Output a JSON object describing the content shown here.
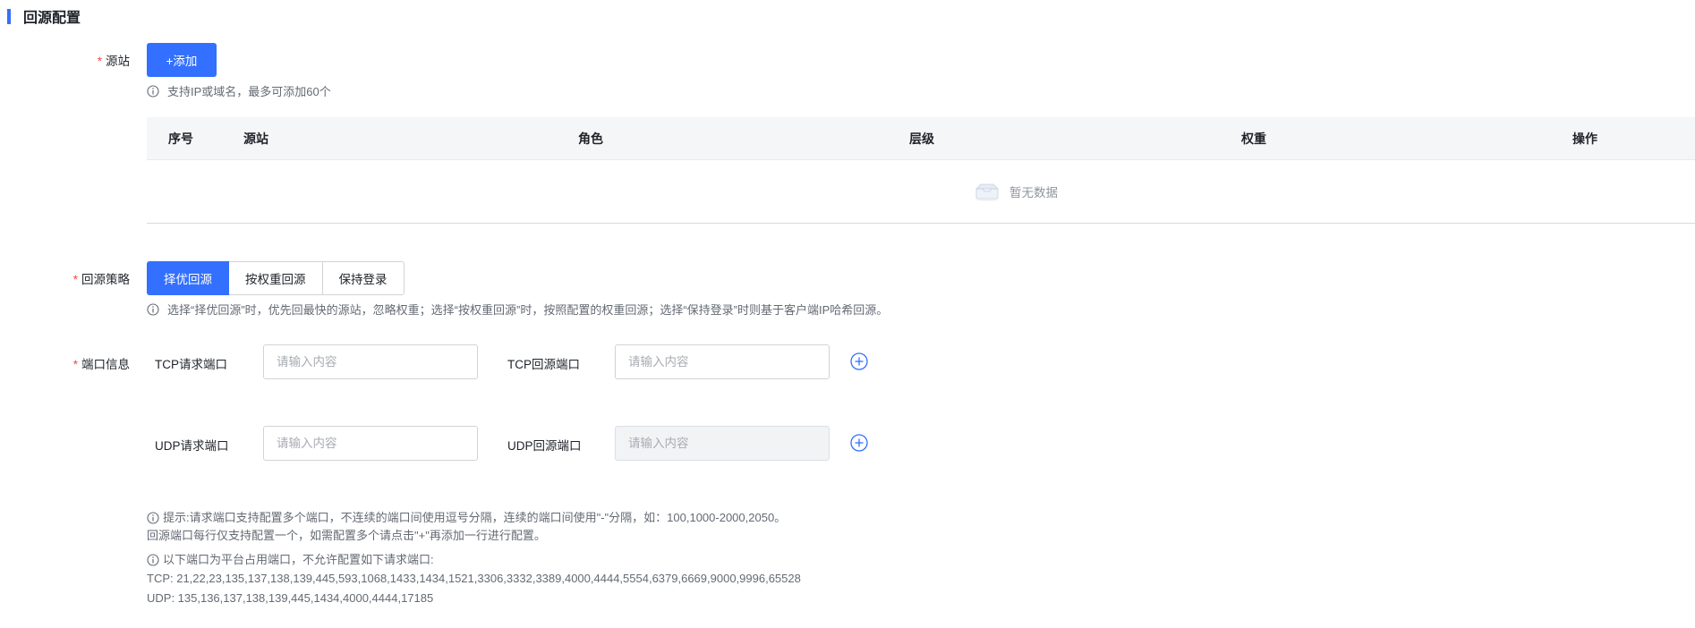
{
  "section": {
    "title": "回源配置"
  },
  "origin": {
    "label": "源站",
    "required_mark": "*",
    "add_button": "+添加",
    "hint": "支持IP或域名，最多可添加60个"
  },
  "table": {
    "columns": [
      "序号",
      "源站",
      "角色",
      "层级",
      "权重",
      "操作"
    ],
    "empty_text": "暂无数据"
  },
  "strategy": {
    "label": "回源策略",
    "required_mark": "*",
    "options": [
      "择优回源",
      "按权重回源",
      "保持登录"
    ],
    "selected": "择优回源",
    "hint": "选择“择优回源”时，优先回最快的源站，忽略权重；选择“按权重回源”时，按照配置的权重回源；选择“保持登录”时则基于客户端IP哈希回源。"
  },
  "ports": {
    "label": "端口信息",
    "required_mark": "*",
    "tcp_request_label": "TCP请求端口",
    "tcp_origin_label": "TCP回源端口",
    "udp_request_label": "UDP请求端口",
    "udp_origin_label": "UDP回源端口",
    "placeholder": "请输入内容"
  },
  "notes": {
    "tip_line1": "提示:请求端口支持配置多个端口，不连续的端口间使用逗号分隔，连续的端口间使用\"-\"分隔，如：100,1000-2000,2050。",
    "tip_line2": "回源端口每行仅支持配置一个，如需配置多个请点击\"+\"再添加一行进行配置。",
    "reserved_title": "以下端口为平台占用端口，不允许配置如下请求端口:",
    "tcp_reserved": "TCP: 21,22,23,135,137,138,139,445,593,1068,1433,1434,1521,3306,3332,3389,4000,4444,5554,6379,6669,9000,9996,65528",
    "udp_reserved": "UDP: 135,136,137,138,139,445,1434,4000,4444,17185"
  },
  "colors": {
    "primary": "#3370ff",
    "required": "#f54a45",
    "hint_text": "#646a73"
  },
  "icons": {
    "info": "info-circle-icon",
    "add": "plus-circle-icon",
    "empty": "empty-box-icon"
  }
}
